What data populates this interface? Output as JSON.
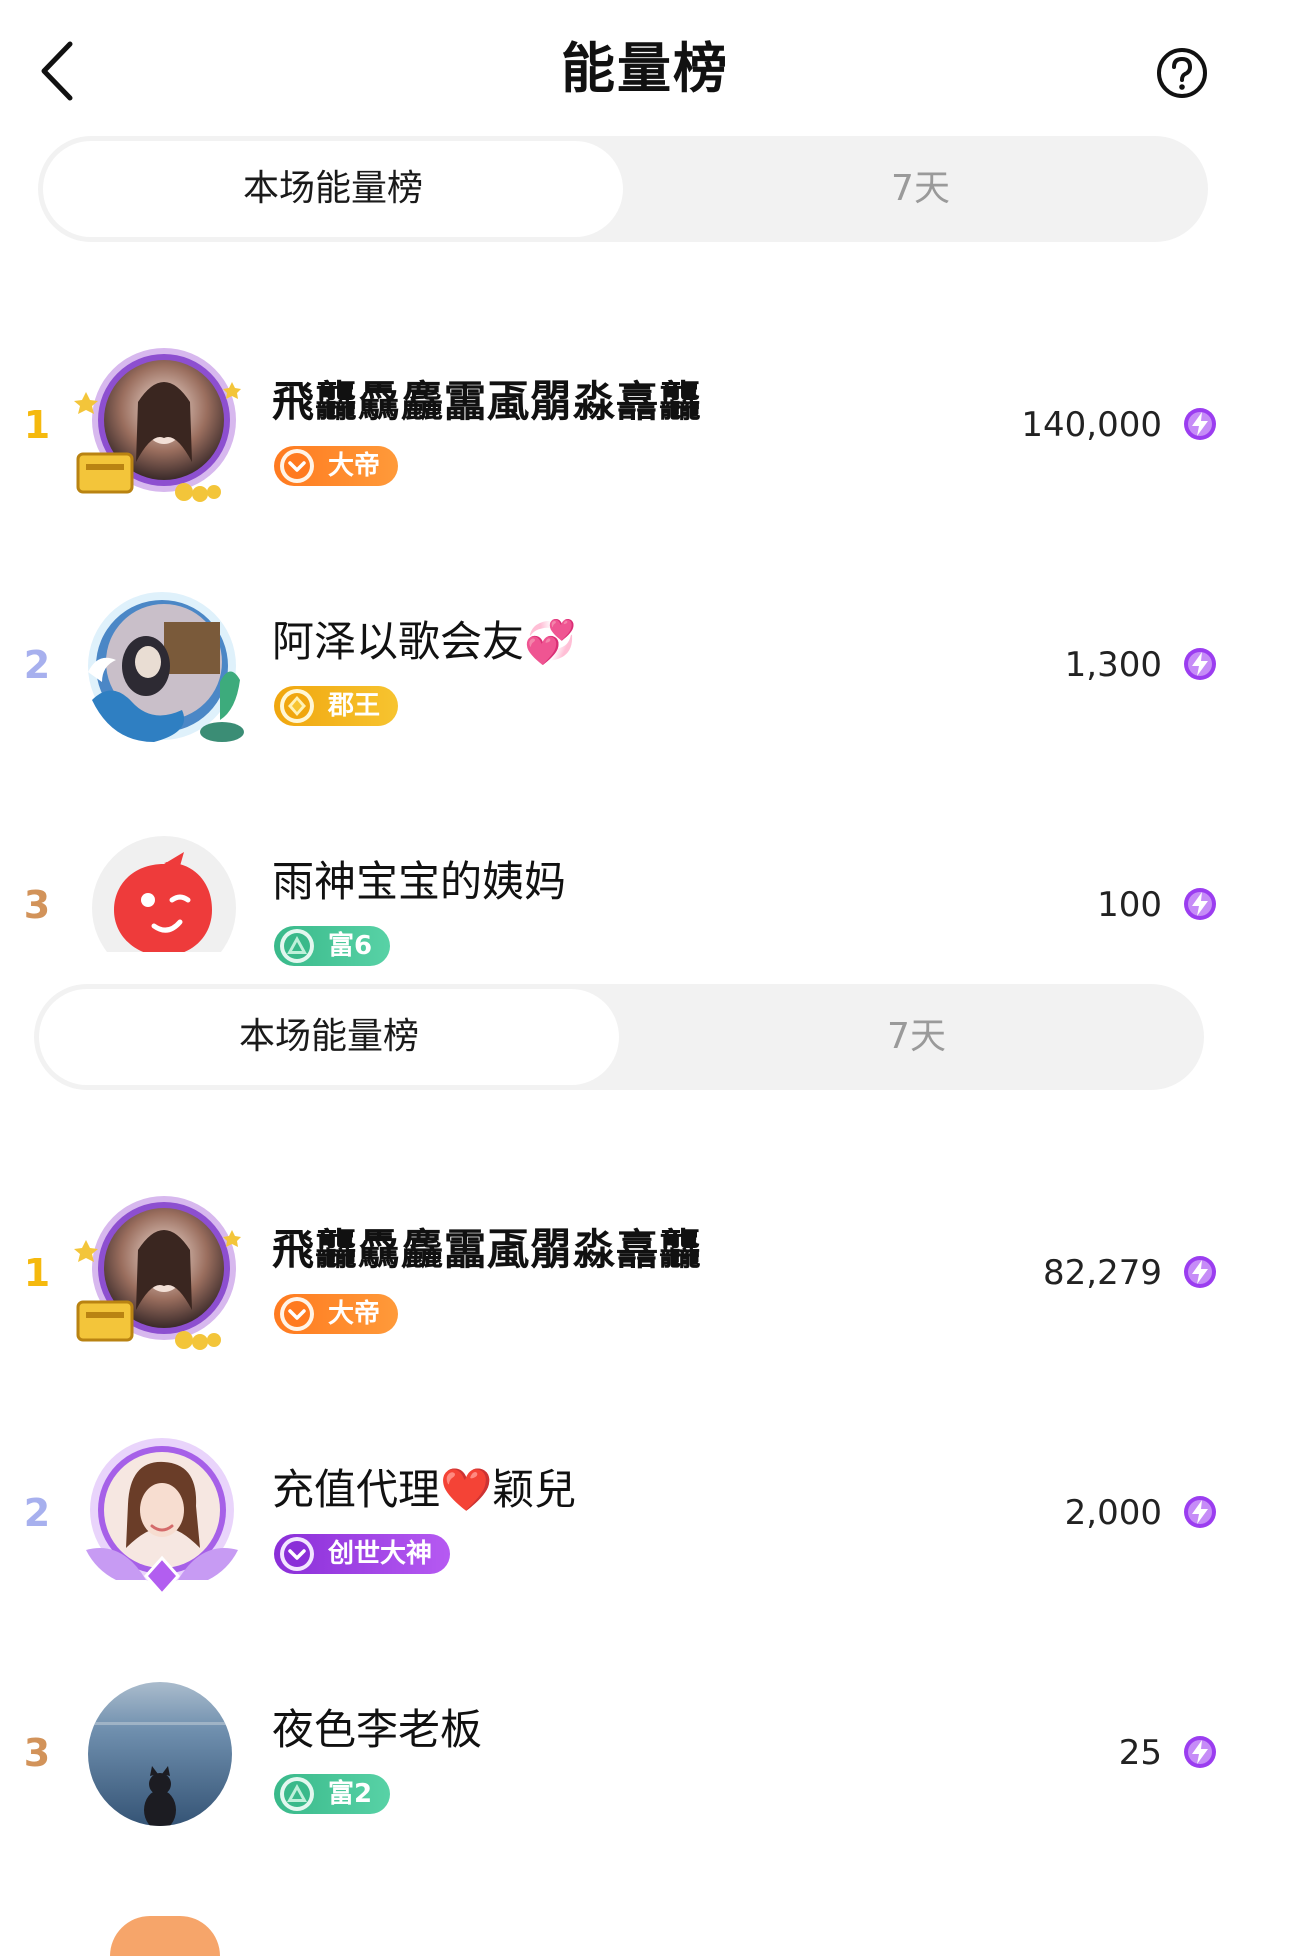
{
  "header": {
    "title": "能量榜",
    "back_icon": "chevron-left-icon",
    "help_icon": "question-circle-icon"
  },
  "sections": [
    {
      "tabs": [
        {
          "label": "本场能量榜",
          "active": true
        },
        {
          "label": "7天",
          "active": false
        }
      ],
      "rows": [
        {
          "rank": "1",
          "name": "飛龘驫麤靁颪朤淼譶龘",
          "badge": "大帝",
          "badge_color": "#ff7a1f",
          "score": "140,000"
        },
        {
          "rank": "2",
          "name": "阿泽以歌会友💞",
          "badge": "郡王",
          "badge_color": "#f0a60e",
          "score": "1,300"
        },
        {
          "rank": "3",
          "name": "雨神宝宝的姨妈",
          "badge": "富6",
          "badge_color": "#39b98a",
          "score": "100"
        }
      ]
    },
    {
      "tabs": [
        {
          "label": "本场能量榜",
          "active": true
        },
        {
          "label": "7天",
          "active": false
        }
      ],
      "rows": [
        {
          "rank": "1",
          "name": "飛龘驫麤靁颪朤淼譶龘",
          "badge": "大帝",
          "badge_color": "#ff7a1f",
          "score": "82,279"
        },
        {
          "rank": "2",
          "name": "充值代理❤️颖兒",
          "badge": "创世大神",
          "badge_color": "#8a2ed8",
          "score": "2,000"
        },
        {
          "rank": "3",
          "name": "夜色李老板",
          "badge": "富2",
          "badge_color": "#39b98a",
          "score": "25"
        }
      ]
    }
  ],
  "colors": {
    "rank1": "#f5b90e",
    "rank2": "#a7b0ee",
    "rank3": "#d2935a",
    "energy": "#9b3df0"
  }
}
